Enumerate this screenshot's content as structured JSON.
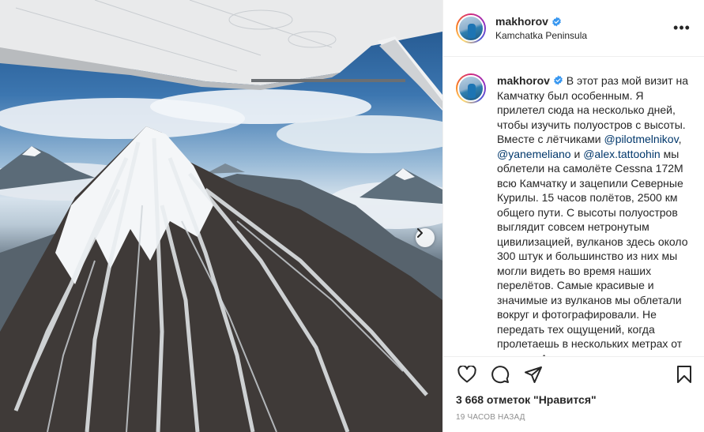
{
  "post": {
    "username": "makhorov",
    "location": "Kamchatka Peninsula",
    "more_label": "•••",
    "caption": {
      "text_1": " В этот раз мой визит на Камчатку был особенным. Я прилетел сюда на несколько дней, чтобы изучить полуостров с высоты. Вместе с лётчиками ",
      "mention_1": "@pilotmelnikov",
      "text_2": ", ",
      "mention_2": "@yanemeliano",
      "text_3": " и ",
      "mention_3": "@alex.tattoohin",
      "text_4": " мы облетели на самолёте Cessna 172M всю Камчатку и зацепили Северные Курилы. 15 часов полётов, 2500 км общего пути. С высоты полуостров выглядит совсем нетронутым цивилизацией, вулканов здесь около 300 штук и большинство из них мы могли видеть во время наших перелётов. Самые красивые и значимые из вулканов мы облетали вокруг и фотографировали. Не передать тех ощущений, когда пролетаешь в нескольких метрах от кратера Авачинского вулкана или"
    },
    "likes": "3 668 отметок \"Нравится\"",
    "time": "19 ЧАСОВ НАЗАД"
  },
  "icons": {
    "verified": "verified-badge-icon",
    "like": "heart-icon",
    "comment": "comment-icon",
    "share": "share-icon",
    "save": "bookmark-icon",
    "next": "chevron-right-icon"
  },
  "colors": {
    "verified": "#3897f0",
    "mention": "#00376b",
    "muted": "#8e8e8e"
  }
}
